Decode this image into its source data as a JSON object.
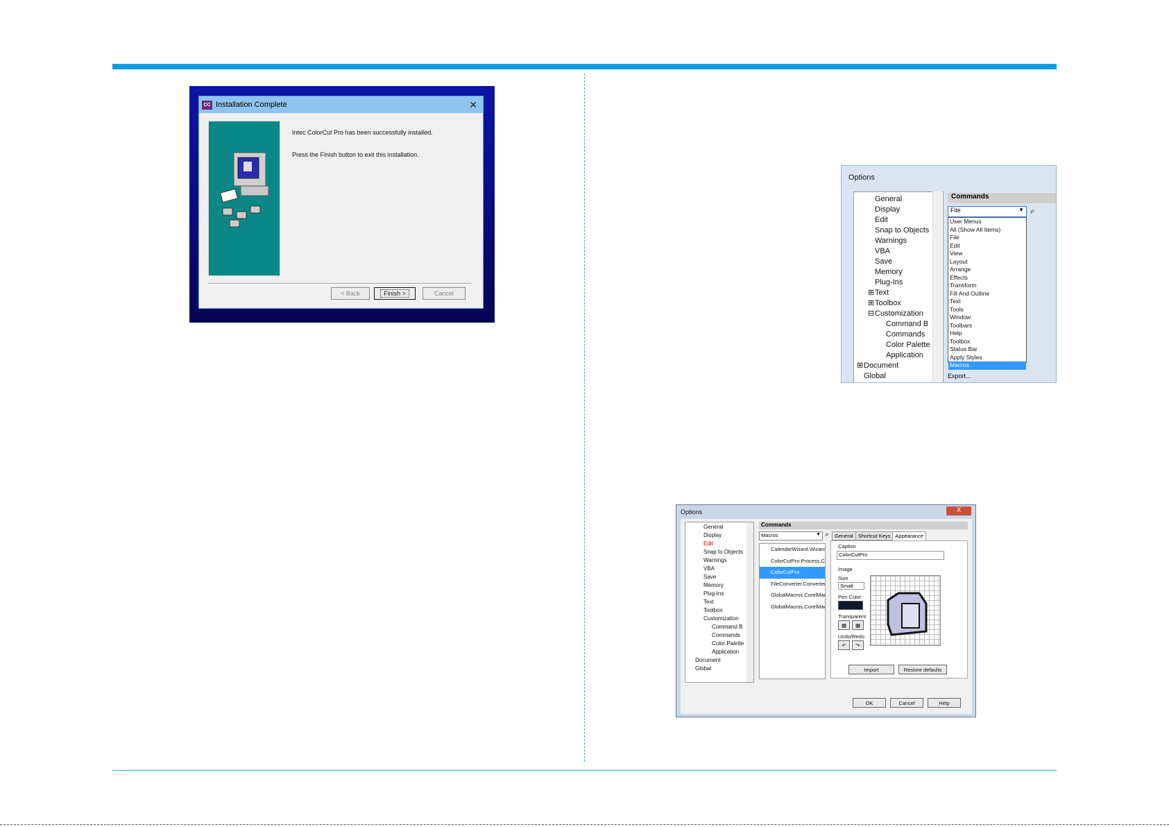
{
  "installer": {
    "title": "Installation Complete",
    "logo": "CC",
    "close": "✕",
    "message1": "Intec ColorCut Pro has been successfully installed.",
    "message2": "Press the Finish button to exit this installation.",
    "back_button": "< Back",
    "finish_button": "Finish >",
    "cancel_button": "Cancel"
  },
  "options_zoom": {
    "title": "Options",
    "tree": [
      "General",
      "Display",
      "Edit",
      "Snap to Objects",
      "Warnings",
      "VBA",
      "Save",
      "Memory",
      "Plug-Ins",
      "Text",
      "Toolbox",
      "Customization",
      "Command B",
      "Commands",
      "Color Palette",
      "Application",
      "Document",
      "Global"
    ],
    "commands_header": "Commands",
    "combo_value": "File",
    "dropdown_items": [
      "User Menus",
      "All (Show All Items)",
      "File",
      "Edit",
      "View",
      "Layout",
      "Arrange",
      "Effects",
      "Transform",
      "Fill And Outline",
      "Text",
      "Tools",
      "Window",
      "Toolbars",
      "Help",
      "Toolbox",
      "Status Bar",
      "Apply Styles",
      "Macros"
    ],
    "selected_item": "Macros",
    "export_label": "Export..."
  },
  "options_full": {
    "title": "Options",
    "close": "X",
    "tree": [
      "General",
      "Display",
      "Edit",
      "Snap to Objects",
      "Warnings",
      "VBA",
      "Save",
      "Memory",
      "Plug-Ins",
      "Text",
      "Toolbox",
      "Customization",
      "Command B",
      "Commands",
      "Color Palette",
      "Application",
      "Document",
      "Global"
    ],
    "commands_header": "Commands",
    "combo_value": "Macros",
    "list": [
      "CalendarWizard.Wizard",
      "ColorCutPro.Process.Col",
      "ColorCutPro",
      "FileConverter.Converter",
      "GlobalMacros.CorelMac",
      "GlobalMacros.CorelMac"
    ],
    "tabs": [
      "General",
      "Shortcut Keys",
      "Appearance"
    ],
    "caption_label": "Caption",
    "caption_value": "ColorCutPro",
    "image_label": "Image",
    "size_label": "Size",
    "size_value": "Small",
    "pen_color_label": "Pen Color",
    "transparent_label": "Transparent",
    "undo_redo_label": "Undo/Redo",
    "import_button": "Import",
    "restore_button": "Restore defaults",
    "ok_button": "OK",
    "cancel_button": "Cancel",
    "help_button": "Help"
  }
}
